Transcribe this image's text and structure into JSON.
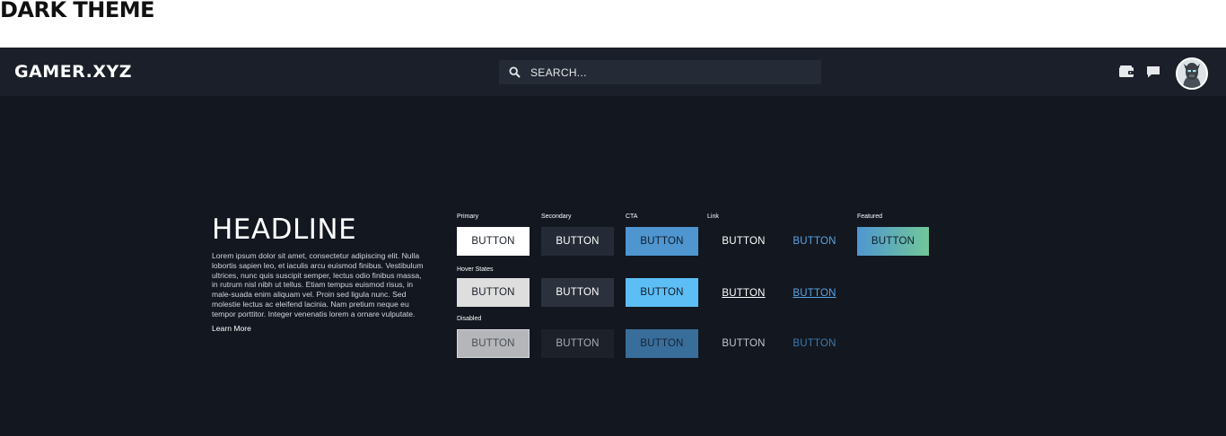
{
  "page_title": "DARK THEME",
  "header": {
    "logo": "GAMER.XYZ",
    "search": {
      "placeholder": "SEARCH..."
    },
    "icons": [
      "wallet-icon",
      "chat-icon"
    ]
  },
  "hero": {
    "headline": "HEADLINE",
    "body": "Lorem ipsum dolor sit amet, consectetur adipiscing elit. Nulla lobortis sapien leo, et iaculis arcu euismod finibus. Vestibulum ultrices, nunc quis suscipit semper, lectus odio finibus massa, in rutrum nisl nibh ut tellus. Etiam tempus euismod risus, in male-suada enim aliquam vel. Proin sed ligula nunc. Sed molestie lectus ac eleifend lacinia. Nam pretium neque eu tempor porttitor. Integer venenatis lorem a ornare vulputate.",
    "learn_more": "Learn More"
  },
  "buttons": {
    "labels": {
      "primary": "Primary",
      "secondary": "Secondary",
      "cta": "CTA",
      "link": "Link",
      "featured": "Featured",
      "hover": "Hover States",
      "disabled": "Disabled"
    },
    "text": "BUTTON"
  },
  "colors": {
    "background": "#121720",
    "navbar": "#1a1f29",
    "cta": "#4f96d1",
    "cta_hover": "#5dbef5",
    "link_blue": "#5aa6e6",
    "featured_end": "#72c799"
  }
}
